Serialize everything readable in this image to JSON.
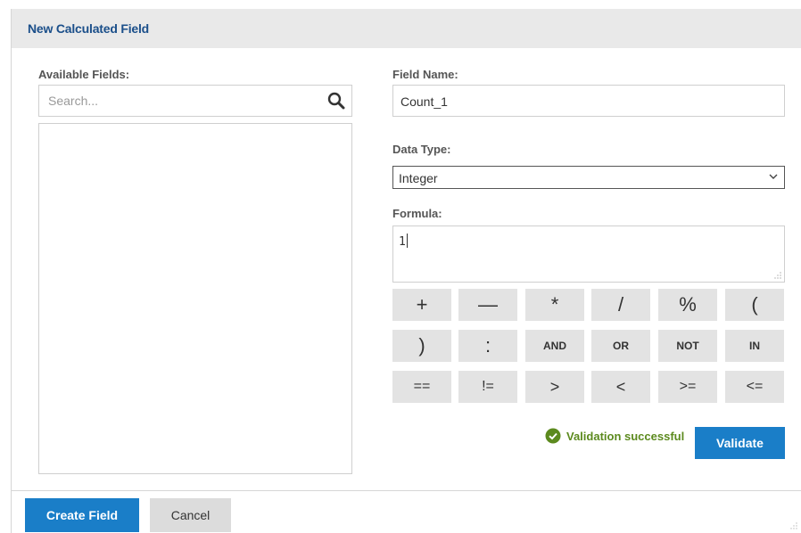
{
  "dialog": {
    "title": "New Calculated Field"
  },
  "available_fields": {
    "label": "Available Fields:",
    "search_placeholder": "Search...",
    "search_value": "",
    "items": []
  },
  "field_name": {
    "label": "Field Name:",
    "value": "Count_1"
  },
  "data_type": {
    "label": "Data Type:",
    "selected": "Integer"
  },
  "formula": {
    "label": "Formula:",
    "value": "1"
  },
  "operators": [
    {
      "label": "+"
    },
    {
      "label": "—"
    },
    {
      "label": "*"
    },
    {
      "label": "/"
    },
    {
      "label": "%"
    },
    {
      "label": "("
    },
    {
      "label": ")"
    },
    {
      "label": ":"
    },
    {
      "label": "AND"
    },
    {
      "label": "OR"
    },
    {
      "label": "NOT"
    },
    {
      "label": "IN"
    },
    {
      "label": "=="
    },
    {
      "label": "!="
    },
    {
      "label": ">"
    },
    {
      "label": "<"
    },
    {
      "label": ">="
    },
    {
      "label": "<="
    }
  ],
  "validation": {
    "message": "Validation successful",
    "button_label": "Validate"
  },
  "footer": {
    "create_label": "Create Field",
    "cancel_label": "Cancel"
  },
  "colors": {
    "title_text": "#1b4f8a",
    "primary_button": "#1a7ec8",
    "success": "#5c8a1e",
    "operator_bg": "#e3e3e3"
  },
  "icons": {
    "search": "search-icon",
    "dropdown": "chevron-down-icon",
    "success": "check-circle-icon",
    "resize": "resize-grip-icon"
  }
}
